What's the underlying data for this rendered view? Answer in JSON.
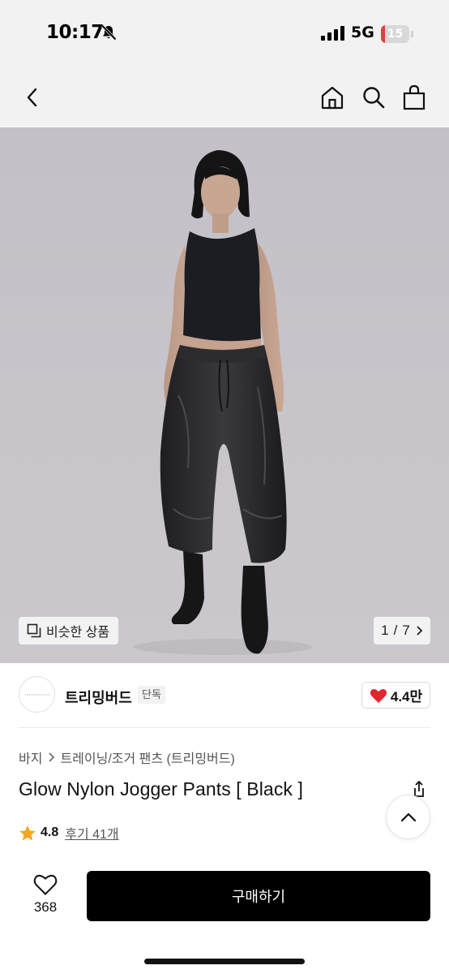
{
  "status_bar": {
    "time": "10:17",
    "network": "5G",
    "battery_level": "15",
    "battery_fraction": 0.15,
    "battery_color": "#e0413d"
  },
  "nav": {
    "back_icon": "chevron-left-icon",
    "home_icon": "home-icon",
    "search_icon": "search-icon",
    "cart_icon": "shopping-bag-icon"
  },
  "hero": {
    "similar_label": "비슷한 상품",
    "page_current": "1",
    "page_total": "7"
  },
  "brand": {
    "name": "트리밍버드",
    "badge": "단독",
    "like_count": "4.4만",
    "like_color": "#e3262b"
  },
  "product": {
    "breadcrumb": [
      "바지",
      "트레이닝/조거 팬츠 (트리밍버드)"
    ],
    "title": "Glow Nylon Jogger Pants [ Black ]",
    "rating": "4.8",
    "review_label": "후기 41개",
    "star_color": "#f5a623"
  },
  "bottom": {
    "wish_count": "368",
    "buy_label": "구매하기"
  }
}
